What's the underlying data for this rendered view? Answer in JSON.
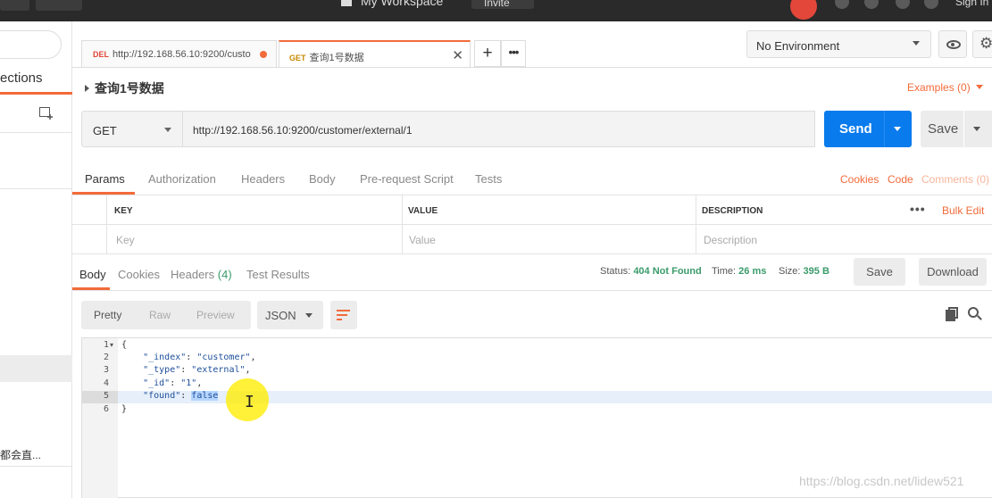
{
  "workspace": {
    "title": "My Workspace",
    "invite_label": "Invite",
    "signin_label": "Sign In"
  },
  "sidebar": {
    "tab_label": "ections",
    "item_label": "都会直..."
  },
  "tabs": [
    {
      "method": "DEL",
      "title": "http://192.168.56.10:9200/custo",
      "unsaved": true
    },
    {
      "method": "GET",
      "title": "查询1号数据",
      "active": true
    }
  ],
  "environment": {
    "selected": "No Environment"
  },
  "request": {
    "name": "查询1号数据",
    "examples_label": "Examples (0)",
    "method": "GET",
    "url": "http://192.168.56.10:9200/customer/external/1",
    "send_label": "Send",
    "save_label": "Save"
  },
  "request_tabs": [
    "Params",
    "Authorization",
    "Headers",
    "Body",
    "Pre-request Script",
    "Tests"
  ],
  "request_links": {
    "cookies": "Cookies",
    "code": "Code",
    "comments": "Comments (0)"
  },
  "params_table": {
    "headers": [
      "KEY",
      "VALUE",
      "DESCRIPTION"
    ],
    "placeholders": [
      "Key",
      "Value",
      "Description"
    ],
    "more": "•••",
    "bulk_edit": "Bulk Edit"
  },
  "response": {
    "tabs": {
      "body": "Body",
      "cookies": "Cookies",
      "headers": "Headers",
      "headers_count": "(4)",
      "tests": "Test Results"
    },
    "status_label": "Status:",
    "status_value": "404 Not Found",
    "time_label": "Time:",
    "time_value": "26 ms",
    "size_label": "Size:",
    "size_value": "395 B",
    "save_label": "Save",
    "download_label": "Download",
    "views": [
      "Pretty",
      "Raw",
      "Preview"
    ],
    "format": "JSON",
    "lines": [
      "1",
      "2",
      "3",
      "4",
      "5",
      "6"
    ],
    "json": {
      "open": "{",
      "index_key": "\"_index\"",
      "index_val": "\"customer\"",
      "type_key": "\"_type\"",
      "type_val": "\"external\"",
      "id_key": "\"_id\"",
      "id_val": "\"1\"",
      "found_key": "\"found\"",
      "found_val": "false",
      "close": "}"
    }
  },
  "watermark": "https://blog.csdn.net/lidew521",
  "colors": {
    "accent": "#f26b3a",
    "send": "#097bed",
    "status_ok_text": "#3a9b6a"
  }
}
